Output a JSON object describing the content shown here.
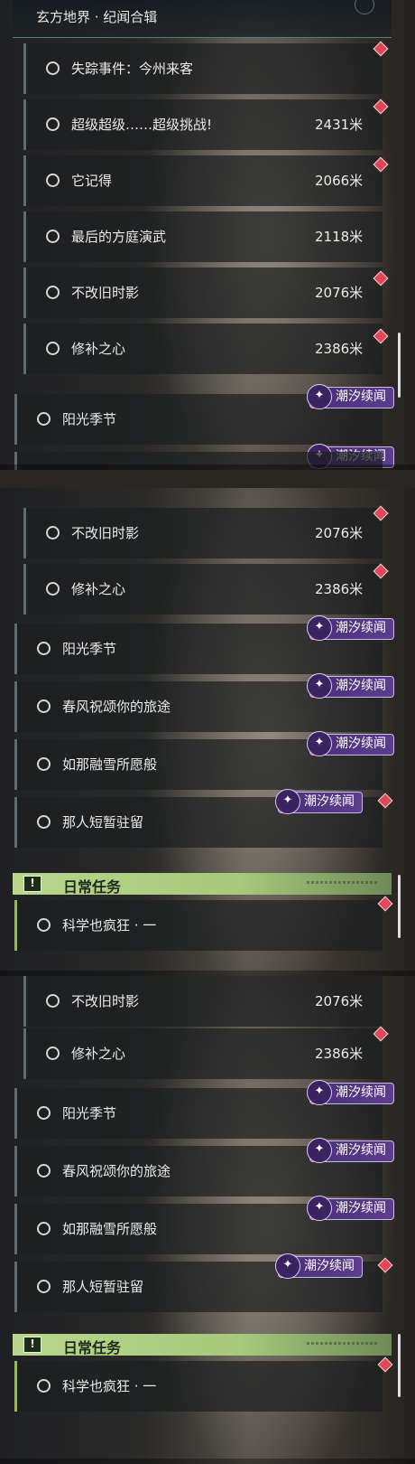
{
  "header": {
    "title": "玄方地界 · 纪闻合辑"
  },
  "tag_label": "潮汐续闻",
  "daily_label": "日常任务",
  "daily_icon": "!",
  "tag_icon": "✦",
  "quests": {
    "q_missing": "失踪事件：今州来客",
    "q_super": "超级超级……超级挑战!",
    "q_remember": "它记得",
    "q_last": "最后的方庭演武",
    "q_unchanged": "不改旧时影",
    "q_mend": "修补之心",
    "q_sun": "阳光季节",
    "q_spring": "春风祝颂你的旅途",
    "q_snow": "如那融雪所愿般",
    "q_stay": "那人短暂驻留",
    "q_science": "科学也疯狂 · 一"
  },
  "distances": {
    "d_super": "2431米",
    "d_remember": "2066米",
    "d_last": "2118米",
    "d_unchanged": "2076米",
    "d_mend": "2386米"
  },
  "colors": {
    "marker": "#e0485a",
    "tag": "#4b2f78",
    "daily_bar": "#b8d68c"
  }
}
